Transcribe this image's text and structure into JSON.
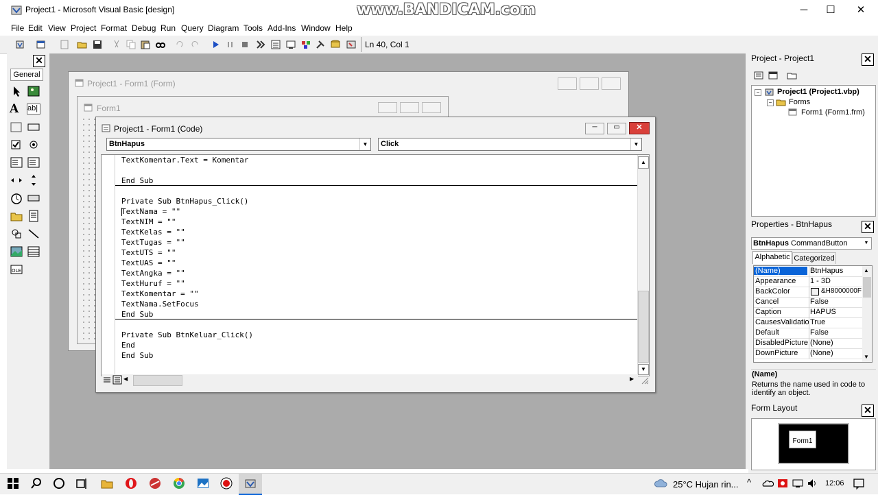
{
  "window": {
    "title": "Project1 - Microsoft Visual Basic [design]",
    "watermark": "www.BANDICAM.com",
    "minimize": "─",
    "maximize": "☐",
    "close": "✕"
  },
  "menu": [
    "File",
    "Edit",
    "View",
    "Project",
    "Format",
    "Debug",
    "Run",
    "Query",
    "Diagram",
    "Tools",
    "Add-Ins",
    "Window",
    "Help"
  ],
  "toolbar": {
    "position": "Ln 40, Col 1"
  },
  "toolbox": {
    "tab": "General",
    "close": "✕"
  },
  "form_window": {
    "title": "Project1 - Form1 (Form)",
    "inner_title": "Form1"
  },
  "code_window": {
    "title": "Project1 - Form1 (Code)",
    "object_combo": "BtnHapus",
    "proc_combo": "Click",
    "lines_top": [
      "TextKomentar.Text = Komentar",
      "",
      "End Sub"
    ],
    "lines_mid": [
      "Private Sub BtnHapus_Click()",
      "TextNama = \"\"",
      "TextNIM = \"\"",
      "TextKelas = \"\"",
      "TextTugas = \"\"",
      "TextUTS = \"\"",
      "TextUAS = \"\"",
      "TextAngka = \"\"",
      "TextHuruf = \"\"",
      "TextKomentar = \"\"",
      "TextNama.SetFocus",
      "End Sub"
    ],
    "lines_bottom": [
      "Private Sub BtnKeluar_Click()",
      "End",
      "End Sub"
    ]
  },
  "project_explorer": {
    "title": "Project - Project1",
    "root": "Project1 (Project1.vbp)",
    "folder": "Forms",
    "item": "Form1 (Form1.frm)",
    "close": "✕"
  },
  "properties": {
    "title": "Properties - BtnHapus",
    "object": "BtnHapus",
    "object_type": "CommandButton",
    "tab_alpha": "Alphabetic",
    "tab_cat": "Categorized",
    "close": "✕",
    "rows": [
      {
        "name": "(Name)",
        "value": "BtnHapus"
      },
      {
        "name": "Appearance",
        "value": "1 - 3D"
      },
      {
        "name": "BackColor",
        "value": "&H8000000F"
      },
      {
        "name": "Cancel",
        "value": "False"
      },
      {
        "name": "Caption",
        "value": "HAPUS"
      },
      {
        "name": "CausesValidation",
        "value": "True"
      },
      {
        "name": "Default",
        "value": "False"
      },
      {
        "name": "DisabledPicture",
        "value": "(None)"
      },
      {
        "name": "DownPicture",
        "value": "(None)"
      }
    ],
    "desc_title": "(Name)",
    "desc_text": "Returns the name used in code to identify an object."
  },
  "form_layout": {
    "title": "Form Layout",
    "form_label": "Form1",
    "close": "✕"
  },
  "taskbar": {
    "weather": "25°C  Hujan rin...",
    "time": "12:06"
  }
}
